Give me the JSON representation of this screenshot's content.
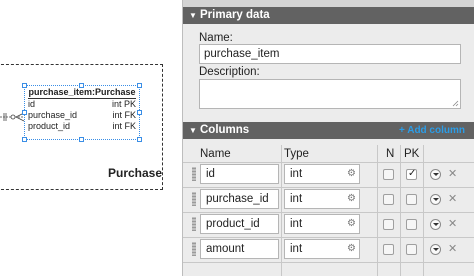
{
  "diagram": {
    "package_name": "Purchase",
    "entity": {
      "title": "purchase_item:Purchase",
      "rows": [
        {
          "name": "id",
          "type": "int PK"
        },
        {
          "name": "purchase_id",
          "type": "int FK"
        },
        {
          "name": "product_id",
          "type": "int FK"
        }
      ]
    }
  },
  "primary_data": {
    "section_title": "Primary data",
    "name_label": "Name:",
    "name_value": "purchase_item",
    "description_label": "Description:",
    "description_value": ""
  },
  "columns": {
    "section_title": "Columns",
    "add_label": "+ Add column",
    "headers": {
      "name": "Name",
      "type": "Type",
      "n": "N",
      "pk": "PK"
    },
    "rows": [
      {
        "name": "id",
        "type": "int",
        "nullable": false,
        "pk": true
      },
      {
        "name": "purchase_id",
        "type": "int",
        "nullable": false,
        "pk": false
      },
      {
        "name": "product_id",
        "type": "int",
        "nullable": false,
        "pk": false
      },
      {
        "name": "amount",
        "type": "int",
        "nullable": false,
        "pk": false
      }
    ]
  },
  "icons": {
    "section_collapse": "triangle-down-icon",
    "type_settings": "gear-icon",
    "row_menu": "dropdown-circle-icon",
    "row_delete": "close-icon",
    "drag": "drag-handle-icon"
  },
  "colors": {
    "section_header_bg": "#626262",
    "add_column_link": "#2b9ce6",
    "selection_handle": "#3a8ee6"
  }
}
